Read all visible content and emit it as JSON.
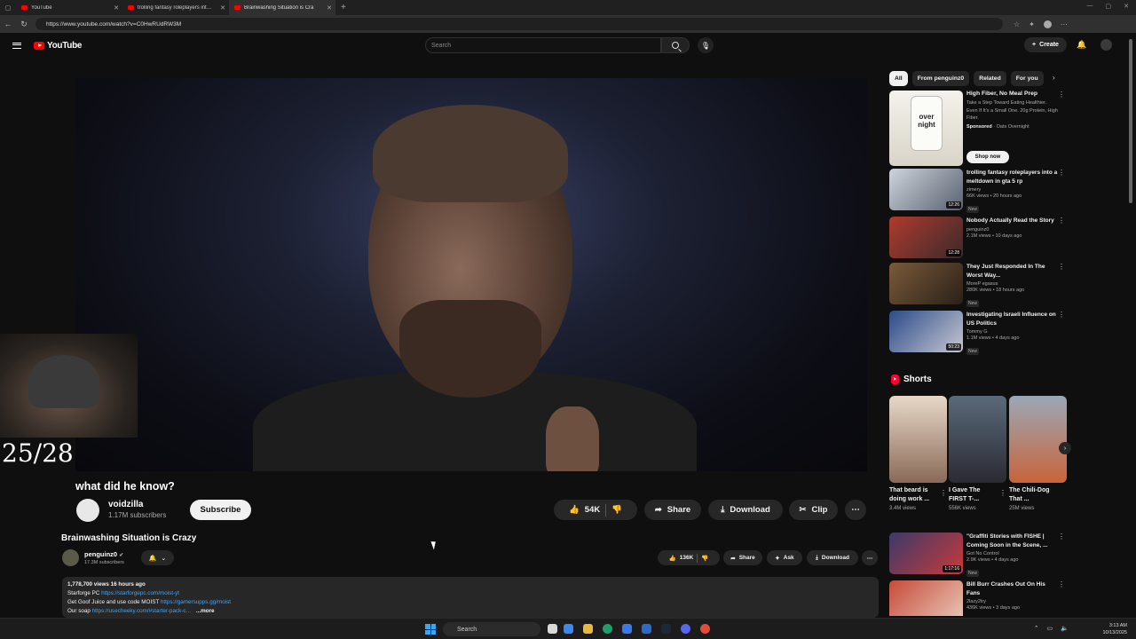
{
  "browser": {
    "tabs": [
      {
        "label": "YouTube",
        "active": false
      },
      {
        "label": "trolling fantasy roleplayers into a",
        "active": false
      },
      {
        "label": "Brainwashing Situation is Cra",
        "active": true
      }
    ],
    "url": "https://www.youtube.com/watch?v=C0HwRUdRW3M"
  },
  "header": {
    "logo_text": "YouTube",
    "search_placeholder": "Search",
    "create_label": "Create"
  },
  "overlay": {
    "counter": "25/28",
    "prev_title": "what did he know?",
    "prev_channel": "voidzilla",
    "prev_subs": "1.17M subscribers",
    "subscribe_label": "Subscribe",
    "likes": "54K",
    "share_label": "Share",
    "download_label": "Download",
    "clip_label": "Clip"
  },
  "video": {
    "title": "Brainwashing Situation is Crazy",
    "channel": "penguinz0",
    "subs": "17.3M subscribers",
    "likes": "136K",
    "share_label": "Share",
    "ask_label": "Ask",
    "download_label": "Download",
    "description": {
      "meta": "1,778,700 views  16 hours ago",
      "line1_prefix": "Starforge PC ",
      "line1_link": "https://starforgepc.com/moist-yt",
      "line2_prefix": "Get Goof Juice and use code MOIST ",
      "line2_link": "https://gamersupps.gg/moist",
      "line3_prefix": "Our soap ",
      "line3_link": "https://usecheeky.com/#starter-pack-c...",
      "more": "...more"
    }
  },
  "sidebar": {
    "chips": [
      "All",
      "From penguinz0",
      "Related",
      "For you"
    ],
    "ad": {
      "title": "High Fiber, No Meal Prep",
      "desc": "Take a Step Toward Eating Healthier. Even If It's a Small One. 20g Protein, High Fiber.",
      "sponsored": "Sponsored",
      "advertiser": "Oats Overnight",
      "cta": "Shop now",
      "jar_text": "over night"
    },
    "recs": [
      {
        "title": "trolling fantasy roleplayers into a meltdown in gta 5 rp",
        "channel": "zimery",
        "views": "66K views  •  20 hours ago",
        "badge": "New",
        "duration": "12:26"
      },
      {
        "title": "Nobody Actually Read the Story",
        "channel": "penguinz0",
        "views": "2.1M views  •  10 days ago",
        "badge": "",
        "duration": "12:28"
      },
      {
        "title": "They Just Responded In The Worst Way...",
        "channel": "MoreP egasus",
        "views": "280K views  •  18 hours ago",
        "badge": "New",
        "duration": ""
      },
      {
        "title": "Investigating Israeli Influence on US Politics",
        "channel": "Tommy G",
        "views": "1.1M views  •  4 days ago",
        "badge": "New",
        "duration": "50:23"
      },
      {
        "title": "\"Graffiti Stories with FISHE | Coming Soon in the Scene, ...",
        "channel": "Got No Control",
        "views": "2.9K views  •  4 days ago",
        "badge": "New",
        "duration": "1:17:16"
      },
      {
        "title": "Bill Burr Crashes Out On His Fans",
        "channel": "2lazy2try",
        "views": "436K views  •  3 days ago",
        "badge": "",
        "duration": ""
      }
    ],
    "shorts_heading": "Shorts",
    "shorts": [
      {
        "title": "That beard is doing work ...",
        "views": "3.4M views",
        "color": "#c9a48a"
      },
      {
        "title": "I Gave The FIRST T-...",
        "views": "556K views",
        "color": "#6b7a8a"
      },
      {
        "title": "The Chili-Dog That ...",
        "views": "25M views",
        "color": "#c8643a"
      }
    ]
  },
  "taskbar": {
    "search_label": "Search",
    "time": "3:13 AM",
    "date": "10/13/2025"
  }
}
